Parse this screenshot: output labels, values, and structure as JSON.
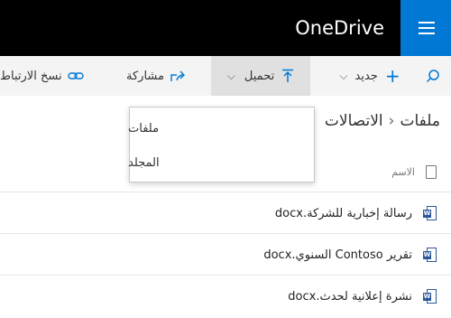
{
  "header": {
    "app_title": "OneDrive"
  },
  "commands": {
    "search_icon": "search-icon",
    "new_label": "جديد",
    "upload_label": "تحميل",
    "share_label": "مشاركة",
    "copy_link_label": "نسخ الارتباط"
  },
  "breadcrumb": {
    "root": "ملفات",
    "current": "الاتصالات"
  },
  "columns": {
    "name": "الاسم"
  },
  "files": [
    {
      "name": "رسالة إخبارية للشركة.docx"
    },
    {
      "name": "تقرير Contoso السنوي.docx"
    },
    {
      "name": "نشرة إعلانية لحدث.docx"
    }
  ],
  "upload_menu": {
    "items": [
      {
        "label": "ملفات"
      },
      {
        "label": "المجلد"
      }
    ]
  },
  "colors": {
    "accent": "#0078d4",
    "header_bg": "#000000",
    "word_blue": "#2b579a"
  }
}
